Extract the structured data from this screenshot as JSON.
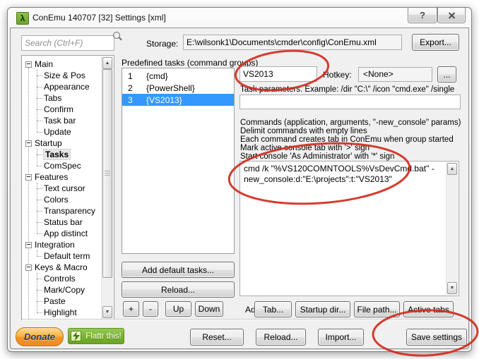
{
  "window": {
    "title": "ConEmu 140707 [32] Settings [xml]",
    "icon_glyph": "λ",
    "help_glyph": "?"
  },
  "header": {
    "search_placeholder": "Search (Ctrl+F)",
    "storage_label": "Storage:",
    "storage_value": "E:\\wilsonk1\\Documents\\cmder\\config\\ConEmu.xml",
    "export_button": "Export..."
  },
  "tree": {
    "items": [
      {
        "label": "Main"
      },
      {
        "label": "Size & Pos"
      },
      {
        "label": "Appearance"
      },
      {
        "label": "Tabs"
      },
      {
        "label": "Confirm"
      },
      {
        "label": "Task bar"
      },
      {
        "label": "Update"
      },
      {
        "label": "Startup"
      },
      {
        "label": "Tasks",
        "selected": true
      },
      {
        "label": "ComSpec"
      },
      {
        "label": "Features"
      },
      {
        "label": "Text cursor"
      },
      {
        "label": "Colors"
      },
      {
        "label": "Transparency"
      },
      {
        "label": "Status bar"
      },
      {
        "label": "App distinct"
      },
      {
        "label": "Integration"
      },
      {
        "label": "Default term"
      },
      {
        "label": "Keys & Macro"
      },
      {
        "label": "Controls"
      },
      {
        "label": "Mark/Copy"
      },
      {
        "label": "Paste"
      },
      {
        "label": "Highlight"
      }
    ]
  },
  "tasks_panel": {
    "header": "Predefined tasks (command groups)",
    "rows": [
      {
        "num": "1",
        "name": "{cmd}"
      },
      {
        "num": "2",
        "name": "{PowerShell}"
      },
      {
        "num": "3",
        "name": "{VS2013}",
        "selected": true
      }
    ],
    "add_default_button": "Add default tasks...",
    "reload_button": "Reload...",
    "plus_button": "+",
    "minus_button": "-",
    "up_button": "Up",
    "down_button": "Down"
  },
  "task_editor": {
    "name_value": "VS2013",
    "hotkey_label": "Hotkey:",
    "hotkey_value": "<None>",
    "hotkey_browse_button": "...",
    "params_hint": "Task parameters. Example: /dir \"C:\\\" /icon \"cmd.exe\" /single",
    "params_value": "",
    "commands_hints": [
      "Commands (application, arguments, \"-new_console\" params)",
      "Delimit commands with empty lines",
      "Each command creates tab in ConEmu when group started",
      "Mark active console tab with '>' sign",
      "Start console 'As Administrator' with '*' sign"
    ],
    "commands_value": "cmd /k \"%VS120COMNTOOLS%VsDevCmd.bat\" -new_console:d:\"E:\\projects\":t:\"VS2013\"",
    "add_label": "Add:",
    "add_buttons": [
      {
        "label": "Tab..."
      },
      {
        "label": "Startup dir..."
      },
      {
        "label": "File path..."
      },
      {
        "label": "Active tabs"
      }
    ]
  },
  "footer": {
    "donate_button": "Donate",
    "flattr_button": "Flattr this!",
    "reset_button": "Reset...",
    "reload_button": "Reload...",
    "import_button": "Import...",
    "save_button": "Save settings"
  },
  "annotation_color": "#d32b1e"
}
